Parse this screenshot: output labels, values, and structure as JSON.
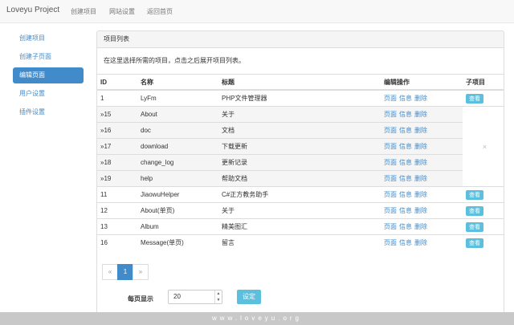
{
  "navbar": {
    "brand": "Loveyu Project",
    "links": [
      "创建项目",
      "网站设置",
      "返回首页"
    ]
  },
  "sidebar": {
    "items": [
      {
        "label": "创建项目"
      },
      {
        "label": "创建子页面"
      },
      {
        "label": "编辑页面",
        "active": true
      },
      {
        "label": "用户设置"
      },
      {
        "label": "插件设置"
      }
    ]
  },
  "panel": {
    "heading": "项目列表",
    "description": "在这里选择所需的项目，点击之后展开项目列表。",
    "columns": {
      "id": "ID",
      "name": "名称",
      "title": "标题",
      "ops": "编辑操作",
      "child": "子项目"
    },
    "actions": {
      "page": "页面",
      "info": "信息",
      "delete": "删除"
    },
    "view_label": "查看",
    "close_mark": "×",
    "rows": [
      {
        "id": "1",
        "name": "LyFm",
        "title": "PHP文件管理器",
        "sub": false
      },
      {
        "id": "»15",
        "name": "About",
        "title": "关于",
        "sub": true
      },
      {
        "id": "»16",
        "name": "doc",
        "title": "文档",
        "sub": true
      },
      {
        "id": "»17",
        "name": "download",
        "title": "下载更新",
        "sub": true
      },
      {
        "id": "»18",
        "name": "change_log",
        "title": "更新记录",
        "sub": true
      },
      {
        "id": "»19",
        "name": "help",
        "title": "帮助文档",
        "sub": true
      },
      {
        "id": "11",
        "name": "JiaowuHelper",
        "title": "C#正方教务助手",
        "sub": false
      },
      {
        "id": "12",
        "name": "About(单页)",
        "title": "关于",
        "sub": false
      },
      {
        "id": "13",
        "name": "Album",
        "title": "精美图汇",
        "sub": false
      },
      {
        "id": "16",
        "name": "Message(单页)",
        "title": "留言",
        "sub": false
      }
    ]
  },
  "pager": {
    "prev": "«",
    "current": "1",
    "next": "»"
  },
  "per_page": {
    "label": "每页显示",
    "value": "20",
    "button": "设定"
  },
  "watermark": "www.loveyu.org"
}
